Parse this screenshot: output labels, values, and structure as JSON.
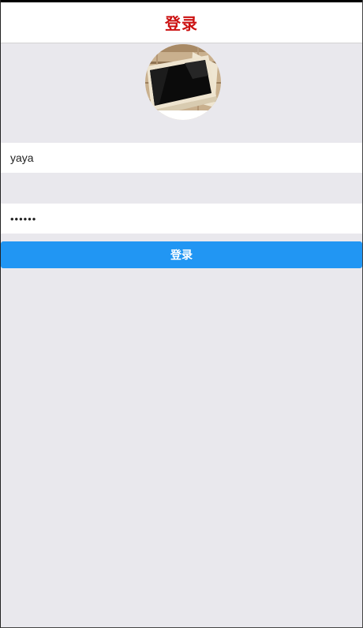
{
  "header": {
    "title": "登录"
  },
  "avatar": {
    "icon": "laptop-photo-icon"
  },
  "form": {
    "username_value": "yaya",
    "password_value": "••••••",
    "login_label": "登录"
  },
  "colors": {
    "title": "#cc1111",
    "button": "#2196f3",
    "background": "#e9e8ed"
  }
}
